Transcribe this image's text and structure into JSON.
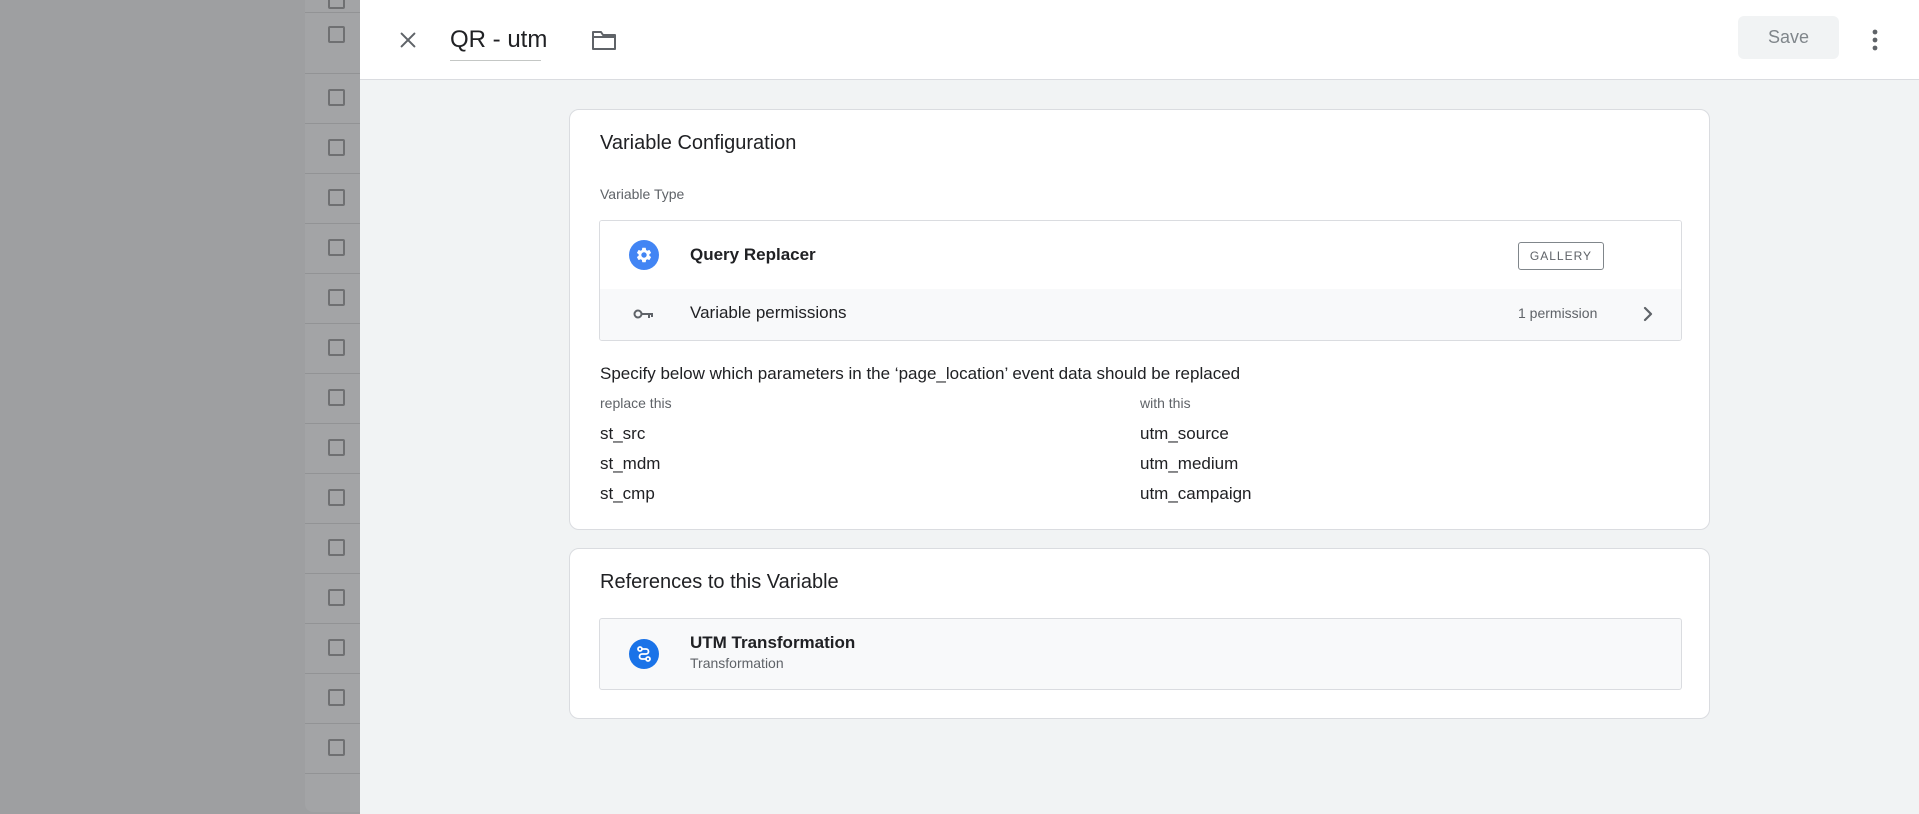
{
  "header": {
    "title": "QR - utm",
    "save_label": "Save"
  },
  "config": {
    "card_title": "Variable Configuration",
    "type_label": "Variable Type",
    "type_name": "Query Replacer",
    "gallery_badge": "GALLERY",
    "permissions_label": "Variable permissions",
    "permissions_count": "1 permission",
    "description": "Specify below which parameters in the ‘page_location’ event data should be replaced",
    "col_replace": "replace this",
    "col_with": "with this",
    "rows": [
      {
        "replace": "st_src",
        "with": "utm_source"
      },
      {
        "replace": "st_mdm",
        "with": "utm_medium"
      },
      {
        "replace": "st_cmp",
        "with": "utm_campaign"
      }
    ]
  },
  "references": {
    "card_title": "References to this Variable",
    "item_name": "UTM Transformation",
    "item_type": "Transformation"
  },
  "colors": {
    "accent": "#4285f4",
    "ref_icon": "#1a73e8",
    "overlay": "#9e9fa1",
    "panel_bg": "#f1f3f4"
  },
  "icons": {
    "close": "close-icon",
    "folder": "folder-icon",
    "more": "more-vert-icon",
    "type": "gear-icon",
    "permissions": "key-icon",
    "chevron": "chevron-right-icon",
    "reference": "transformation-icon"
  }
}
